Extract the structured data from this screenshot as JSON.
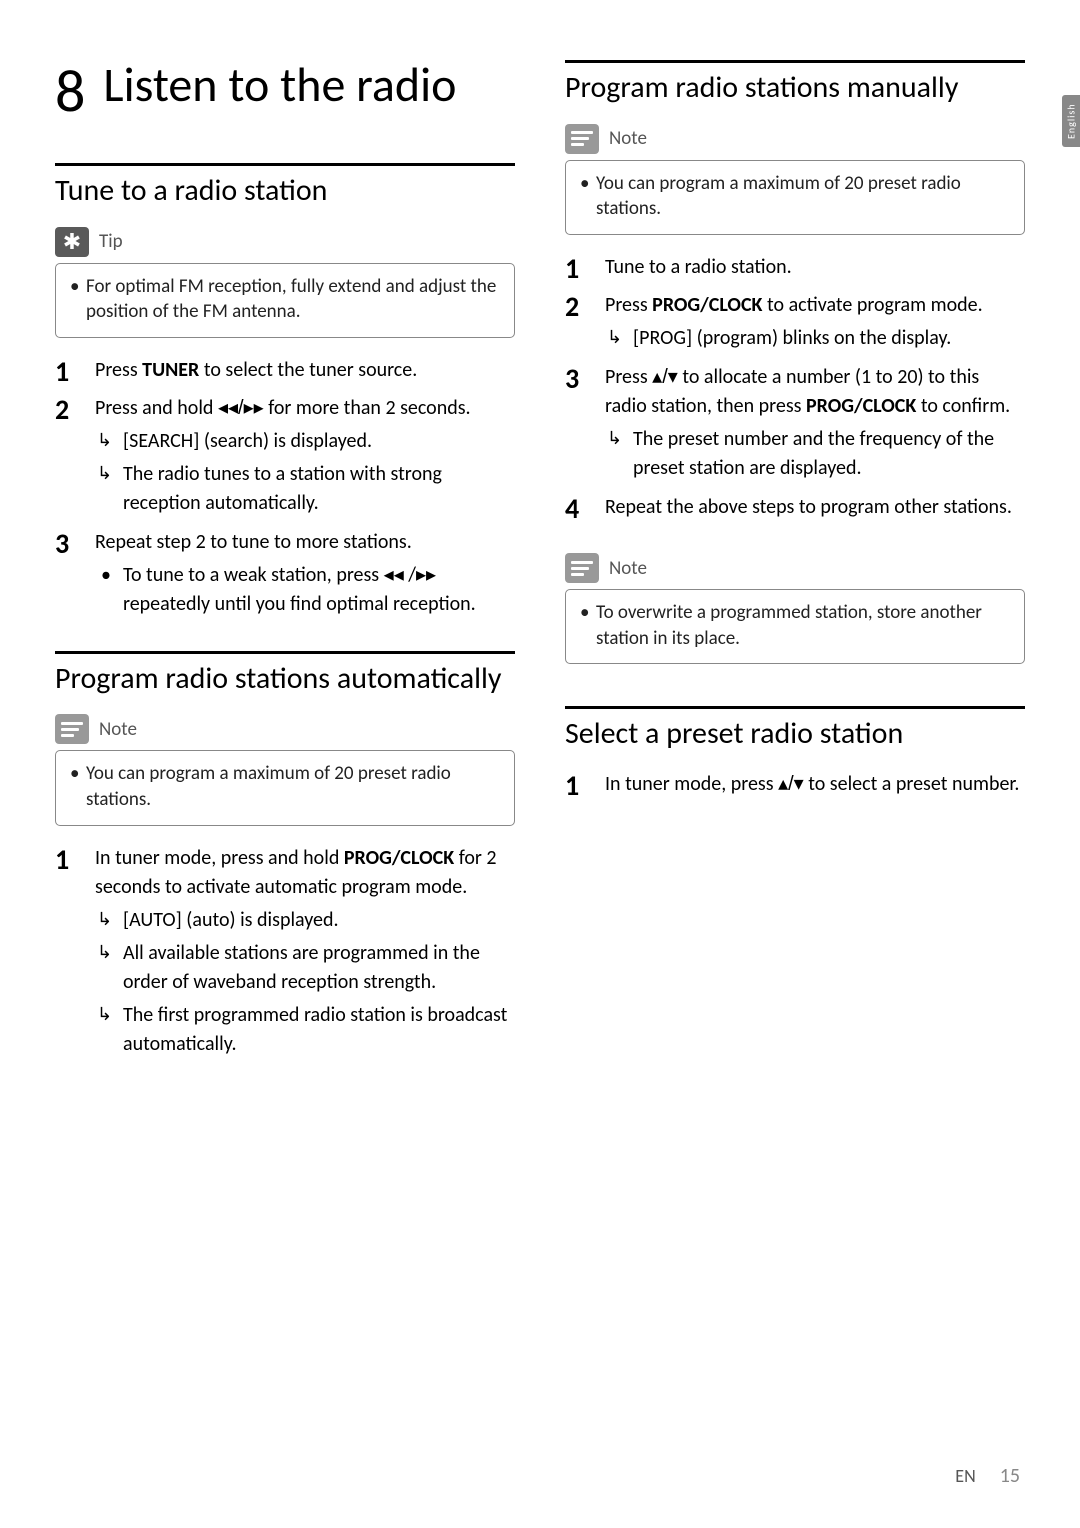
{
  "side_tab": "English",
  "chapter": {
    "num": "8",
    "title": "Listen to the radio"
  },
  "left": {
    "section1": {
      "title": "Tune to a radio station",
      "tip_label": "Tip",
      "tip_body": "For optimal FM reception, fully extend and adjust the position of the FM antenna.",
      "steps": {
        "s1": {
          "num": "1",
          "text_a": "Press ",
          "btn": "TUNER",
          "text_b": " to select the tuner source."
        },
        "s2": {
          "num": "2",
          "text_a": "Press and hold ",
          "glyph": "◂◂/▸▸",
          "text_b": " for more than 2 seconds.",
          "sub1": "[SEARCH] (search) is displayed.",
          "sub2": "The radio tunes to a station with strong reception automatically."
        },
        "s3": {
          "num": "3",
          "text": "Repeat step 2 to tune to more stations.",
          "bullet_a": "To tune to a weak station, press ",
          "glyph1": "◂◂",
          "mid": " /",
          "glyph2": "▸▸",
          "bullet_b": " repeatedly until you find optimal reception."
        }
      }
    },
    "section2": {
      "title": "Program radio stations automatically",
      "note_label": "Note",
      "note_body": "You can program a maximum of 20 preset radio stations.",
      "steps": {
        "s1": {
          "num": "1",
          "text_a": "In tuner mode, press and hold ",
          "btn": "PROG/CLOCK",
          "text_b": " for 2 seconds to activate automatic program mode.",
          "sub1": "[AUTO] (auto) is displayed.",
          "sub2": "All available stations are programmed in the order of waveband reception strength.",
          "sub3": "The first programmed radio station is broadcast automatically."
        }
      }
    }
  },
  "right": {
    "section1": {
      "title": "Program radio stations manually",
      "note_label": "Note",
      "note_body": "You can program a maximum of 20 preset radio stations.",
      "steps": {
        "s1": {
          "num": "1",
          "text": "Tune to a radio station."
        },
        "s2": {
          "num": "2",
          "text_a": "Press ",
          "btn": "PROG/CLOCK",
          "text_b": " to activate program mode.",
          "sub1": "[PROG] (program) blinks on the display."
        },
        "s3": {
          "num": "3",
          "text_a": "Press ",
          "glyph": "▴/▾",
          "text_b": " to allocate a number (1 to 20) to this radio station, then press ",
          "btn": "PROG/CLOCK",
          "text_c": " to confirm.",
          "sub1": "The preset number and the frequency of the preset station are displayed."
        },
        "s4": {
          "num": "4",
          "text": "Repeat the above steps to program other stations."
        }
      },
      "note2_label": "Note",
      "note2_body": "To overwrite a programmed station, store another station in its place."
    },
    "section2": {
      "title": "Select a preset radio station",
      "steps": {
        "s1": {
          "num": "1",
          "text_a": "In tuner mode, press ",
          "glyph": "▴/▾",
          "text_b": " to select a preset number."
        }
      }
    }
  },
  "footer": {
    "lang": "EN",
    "page": "15"
  }
}
